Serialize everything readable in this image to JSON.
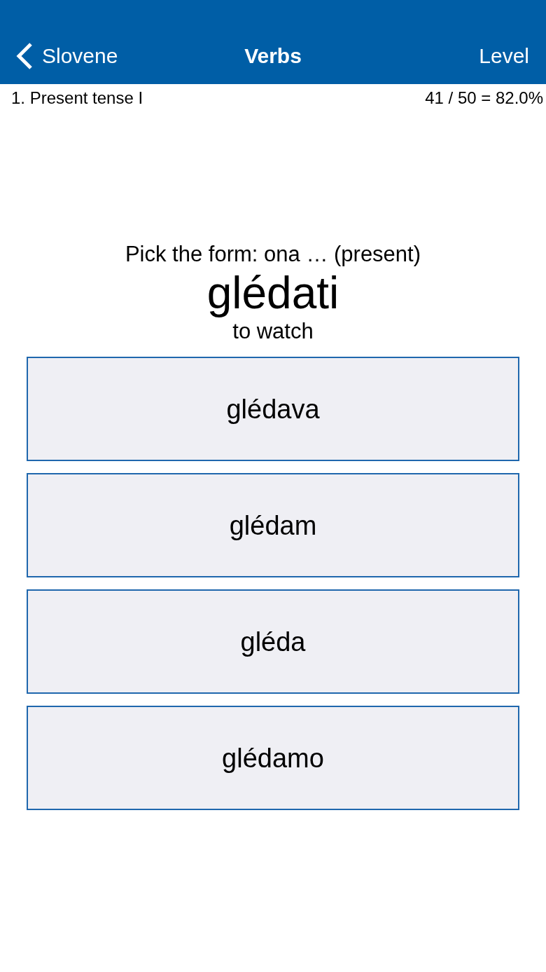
{
  "nav": {
    "back_label": "Slovene",
    "title": "Verbs",
    "right_label": "Level"
  },
  "progress": {
    "lesson": "1. Present tense I",
    "score": "41 / 50 = 82.0%"
  },
  "question": {
    "prompt": "Pick the form: ona … (present)",
    "word": "glédati",
    "translation": "to watch"
  },
  "options": [
    {
      "label": "glédava"
    },
    {
      "label": "glédam"
    },
    {
      "label": "gléda"
    },
    {
      "label": "glédamo"
    }
  ]
}
